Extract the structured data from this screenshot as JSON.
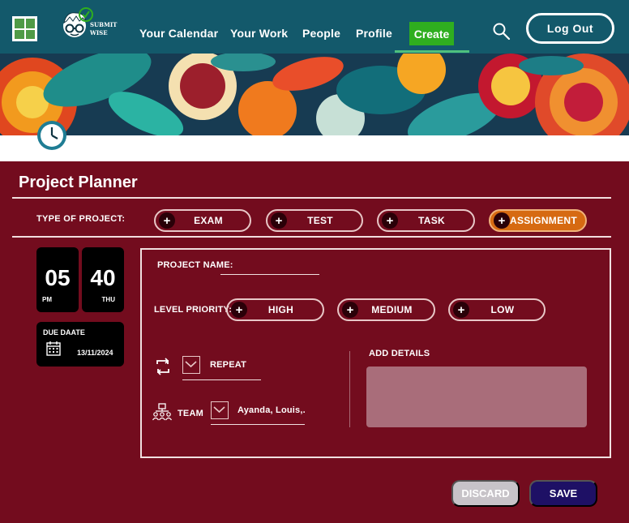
{
  "nav": {
    "brand_line1": "SUBMIT",
    "brand_line2": "WISE",
    "links": [
      "Your Calendar",
      "Your Work",
      "People",
      "Profile"
    ],
    "create_label": "Create",
    "logout_label": "Log Out"
  },
  "page": {
    "title": "Project Planner",
    "type_label": "TYPE OF PROJECT:",
    "project_types": [
      "EXAM",
      "TEST",
      "TASK",
      "ASSIGNMENT"
    ],
    "active_type": "ASSIGNMENT"
  },
  "time": {
    "hour": "05",
    "period": "PM",
    "minute": "40",
    "day": "THU"
  },
  "due": {
    "label": "DUE DAATE",
    "value": "13/11/2024"
  },
  "form": {
    "project_name_label": "PROJECT NAME:",
    "project_name_value": "",
    "priority_label": "LEVEL PRIORITY:",
    "priorities": [
      "HIGH",
      "MEDIUM",
      "LOW"
    ],
    "repeat_label": "REPEAT",
    "team_label": "TEAM",
    "team_value": "Ayanda, Louis,.",
    "details_label": "ADD DETAILS",
    "details_value": ""
  },
  "actions": {
    "discard_label": "DISCARD",
    "save_label": "SAVE"
  },
  "colors": {
    "nav_bg": "#13596b",
    "page_bg": "#730c1e",
    "create_bg": "#2fae1f",
    "active_pill": "#d66a12",
    "save_bg": "#1e1065",
    "discard_bg": "#c7c3c8"
  },
  "icons": [
    "grid-logo-icon",
    "mascot-icon",
    "search-icon",
    "clock-icon",
    "calendar-icon",
    "repeat-icon",
    "team-icon",
    "plus-icon",
    "dropdown-check-icon"
  ]
}
